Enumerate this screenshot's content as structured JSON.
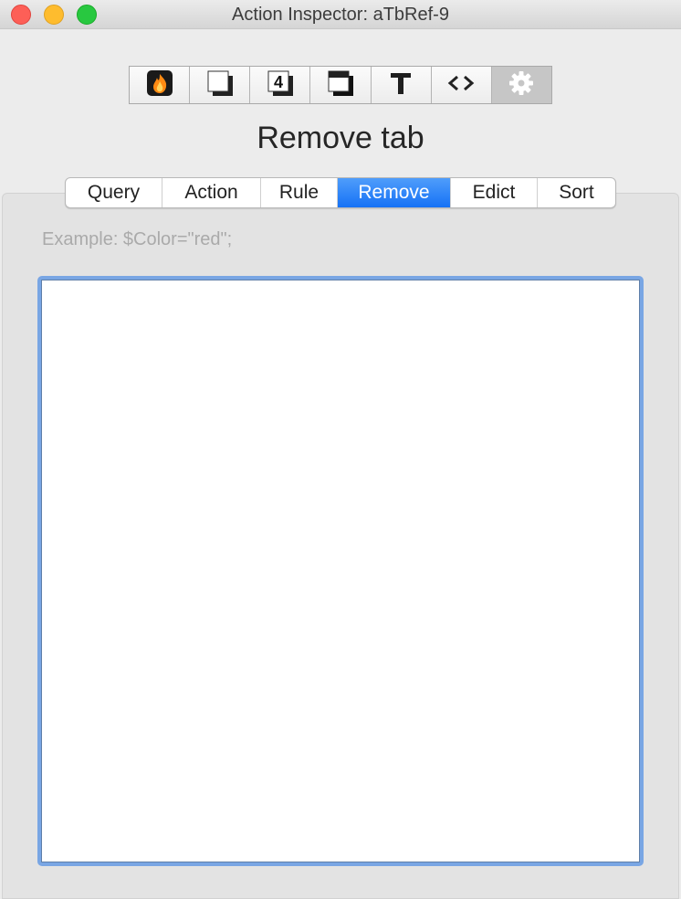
{
  "window": {
    "title": "Action Inspector: aTbRef-9"
  },
  "toolbar": {
    "buttons": [
      {
        "icon": "flame-icon"
      },
      {
        "icon": "note-icon"
      },
      {
        "icon": "number-icon",
        "glyph": "4"
      },
      {
        "icon": "shadow-icon"
      },
      {
        "icon": "text-icon",
        "glyph": "T"
      },
      {
        "icon": "code-icon",
        "glyph": "<>"
      },
      {
        "icon": "gear-icon",
        "selected": true
      }
    ]
  },
  "inspector": {
    "title": "Remove tab"
  },
  "tabs": [
    {
      "label": "Query"
    },
    {
      "label": "Action"
    },
    {
      "label": "Rule"
    },
    {
      "label": "Remove",
      "active": true
    },
    {
      "label": "Edict"
    },
    {
      "label": "Sort"
    }
  ],
  "editor": {
    "placeholder": "Example: $Color=\"red\";",
    "value": ""
  },
  "colors": {
    "active_tab": "#1672f5",
    "focus_ring": "#79a6e4",
    "close": "#fd5f57",
    "minimize": "#febc2e",
    "zoom": "#28c840"
  }
}
